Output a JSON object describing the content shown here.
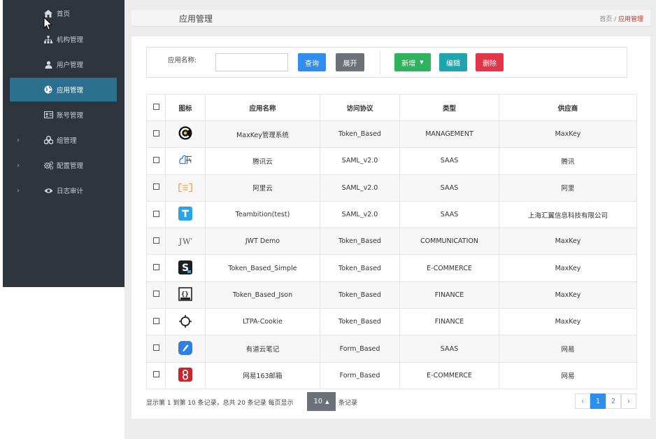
{
  "sidebar": {
    "items": [
      {
        "label": "首页",
        "icon": "home-icon"
      },
      {
        "label": "机构管理",
        "icon": "sitemap-icon"
      },
      {
        "label": "用户管理",
        "icon": "user-icon"
      },
      {
        "label": "应用管理",
        "icon": "globe-icon",
        "active": true
      },
      {
        "label": "账号管理",
        "icon": "id-card-icon"
      },
      {
        "label": "组管理",
        "icon": "group-icon",
        "expandable": true
      },
      {
        "label": "配置管理",
        "icon": "cogs-icon",
        "expandable": true
      },
      {
        "label": "日志审计",
        "icon": "eye-icon",
        "expandable": true
      }
    ],
    "expand_arrow": "›"
  },
  "header": {
    "title": "应用管理",
    "breadcrumb_home": "首页",
    "breadcrumb_sep": " / ",
    "breadcrumb_current": "应用管理"
  },
  "search": {
    "label": "应用名称:",
    "value": "",
    "query_label": "查询",
    "expand_label": "展开"
  },
  "actions": {
    "add_label": "新增",
    "edit_label": "编辑",
    "delete_label": "删除"
  },
  "table": {
    "columns": [
      "图标",
      "应用名称",
      "访问协议",
      "类型",
      "供应商"
    ],
    "rows": [
      {
        "icon": "maxkey-icon",
        "name": "MaxKey管理系统",
        "protocol": "Token_Based",
        "type": "MANAGEMENT",
        "vendor": "MaxKey"
      },
      {
        "icon": "tencent-cloud-icon",
        "name": "腾讯云",
        "protocol": "SAML_v2.0",
        "type": "SAAS",
        "vendor": "腾讯"
      },
      {
        "icon": "aliyun-icon",
        "name": "阿里云",
        "protocol": "SAML_v2.0",
        "type": "SAAS",
        "vendor": "阿里"
      },
      {
        "icon": "teambition-icon",
        "name": "Teambition(test)",
        "protocol": "SAML_v2.0",
        "type": "SAAS",
        "vendor": "上海汇翼信息科技有限公司"
      },
      {
        "icon": "jwt-icon",
        "name": "JWT Demo",
        "protocol": "Token_Based",
        "type": "COMMUNICATION",
        "vendor": "MaxKey"
      },
      {
        "icon": "s-logo-icon",
        "name": "Token_Based_Simple",
        "protocol": "Token_Based",
        "type": "E-COMMERCE",
        "vendor": "MaxKey"
      },
      {
        "icon": "json-icon",
        "name": "Token_Based_Json",
        "protocol": "Token_Based",
        "type": "FINANCE",
        "vendor": "MaxKey"
      },
      {
        "icon": "ltpa-icon",
        "name": "LTPA-Cookie",
        "protocol": "Token_Based",
        "type": "FINANCE",
        "vendor": "MaxKey"
      },
      {
        "icon": "youdao-note-icon",
        "name": "有道云笔记",
        "protocol": "Form_Based",
        "type": "SAAS",
        "vendor": "网易"
      },
      {
        "icon": "netease-mail-icon",
        "name": "网易163邮箱",
        "protocol": "Form_Based",
        "type": "E-COMMERCE",
        "vendor": "网易"
      }
    ]
  },
  "pagination": {
    "summary": "显示第 1 到第 10 条记录，总共 20 条记录  每页显示",
    "page_size": "10",
    "per_suffix": "条记录",
    "prev": "‹",
    "pages": [
      "1",
      "2"
    ],
    "current_page": "1",
    "next": "›"
  },
  "colors": {
    "sidebar_bg": "#2f353c",
    "active_item": "#2b6f8e",
    "primary": "#2e8ded",
    "success": "#2fb25d",
    "info": "#1fa6ad",
    "danger": "#e3354a",
    "default": "#6c7278"
  }
}
